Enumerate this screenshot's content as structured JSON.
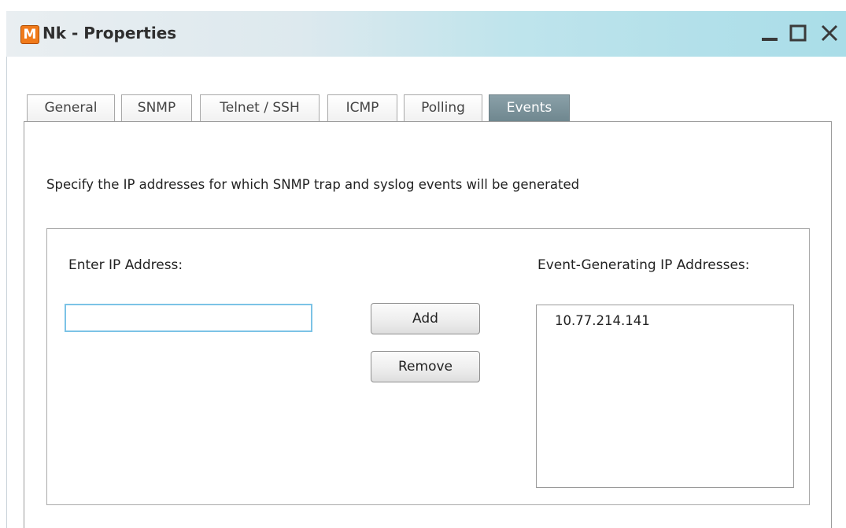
{
  "window": {
    "app_icon_letter": "M",
    "title": "Nk - Properties",
    "controls": {
      "minimize": "minimize-icon",
      "maximize": "maximize-icon",
      "close": "close-icon"
    }
  },
  "tabs": [
    {
      "label": "General"
    },
    {
      "label": "SNMP"
    },
    {
      "label": "Telnet / SSH"
    },
    {
      "label": "ICMP"
    },
    {
      "label": "Polling"
    },
    {
      "label": "Events",
      "active": true
    }
  ],
  "events": {
    "description": "Specify the IP addresses for which SNMP trap and syslog events will be generated",
    "enter_ip_label": "Enter IP Address:",
    "ip_input_value": "",
    "add_label": "Add",
    "remove_label": "Remove",
    "list_label": "Event-Generating IP Addresses:",
    "list_items": [
      "10.77.214.141"
    ]
  },
  "colors": {
    "titlebar_accent": "#a9dde8",
    "active_tab": "#7a9199",
    "app_icon": "#f07a1a",
    "input_focus": "#7cc3e6"
  }
}
